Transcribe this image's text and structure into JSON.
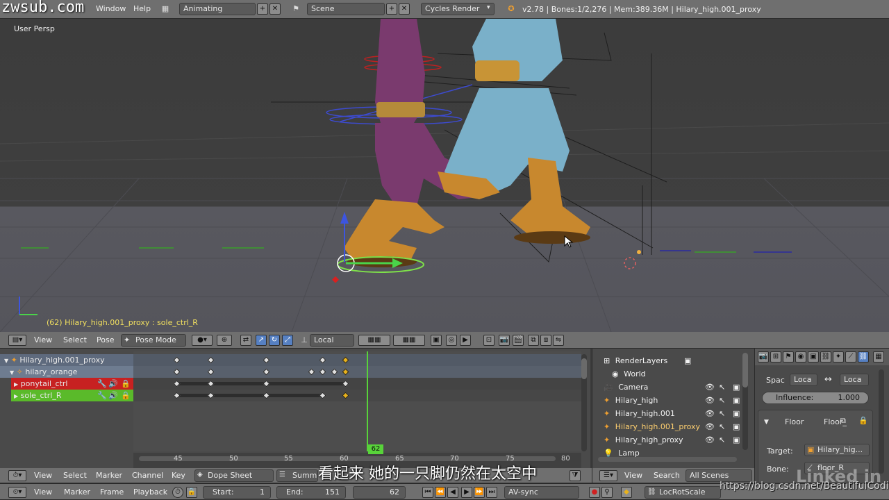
{
  "watermarks": {
    "top_left": "zwsub.com",
    "bottom_right": "https://blog.csdn.net/BeautifulCoding",
    "brand": "Linked in"
  },
  "subtitle": "看起来  她的一只脚仍然在太空中",
  "info_header": {
    "menus": [
      "Window",
      "Help"
    ],
    "screen_layout": "Animating",
    "scene": "Scene",
    "render_engine": "Cycles Render",
    "stats": "v2.78 | Bones:1/2,276 | Mem:389.36M | Hilary_high.001_proxy"
  },
  "viewport": {
    "view_label": "User Persp",
    "status": "(62) Hilary_high.001_proxy : sole_ctrl_R",
    "header": {
      "menus": [
        "View",
        "Select",
        "Pose"
      ],
      "mode": "Pose Mode",
      "orientation": "Local"
    }
  },
  "dopesheet": {
    "channels": [
      {
        "label": "Hilary_high.001_proxy",
        "type": "object"
      },
      {
        "label": "hilary_orange",
        "type": "armature"
      },
      {
        "label": "ponytail_ctrl",
        "type": "group-red"
      },
      {
        "label": "sole_ctrl_R",
        "type": "group-green"
      }
    ],
    "current_frame_badge": "62",
    "ruler_ticks": [
      "45",
      "50",
      "55",
      "60",
      "65",
      "70",
      "75",
      "80"
    ],
    "header": {
      "menus": [
        "View",
        "Select",
        "Marker",
        "Channel",
        "Key"
      ],
      "mode": "Dope Sheet",
      "summary": "Summary"
    }
  },
  "timeline_bar": {
    "menus": [
      "View",
      "Marker",
      "Frame",
      "Playback"
    ],
    "start_label": "Start:",
    "start_value": "1",
    "end_label": "End:",
    "end_value": "151",
    "current": "62",
    "sync": "AV-sync",
    "keying_set": "LocRotScale"
  },
  "outliner": {
    "items": [
      "RenderLayers",
      "World",
      "Camera",
      "Hilary_high",
      "Hilary_high.001",
      "Hilary_high.001_proxy",
      "Hilary_high_proxy",
      "Lamp"
    ],
    "header": {
      "menus": [
        "View",
        "Search"
      ],
      "filter": "All Scenes"
    }
  },
  "properties": {
    "space_label": "Spac",
    "space_a": "Loca",
    "space_b": "Loca",
    "influence_label": "Influence:",
    "influence_value": "1.000",
    "constraint_name": "Floor",
    "constraint_type": "Floor_",
    "target_label": "Target:",
    "target_value": "Hilary_hig...",
    "bone_label": "Bone:",
    "bone_value": "floor_R"
  },
  "colors": {
    "header": "#6f6f6f",
    "viewport_top": "#3d3d3d",
    "viewport_floor": "#58585f",
    "playhead": "#58d33a",
    "keyframe": "#e8e8e8",
    "keyframe_selected": "#e8b21c",
    "red_group": "#c72121",
    "green_group": "#5aba2a",
    "selection_blue": "#5680c2"
  }
}
